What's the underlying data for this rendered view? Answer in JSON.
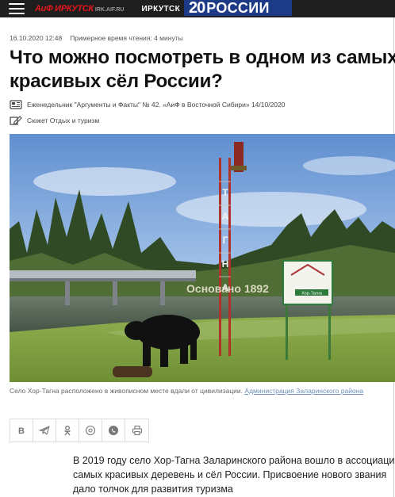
{
  "header": {
    "logo_main": "АиФ ИРКУТСК",
    "logo_sub": "IRK.AIF.RU",
    "city": "ИРКУТСК",
    "promo_number": "20",
    "promo_word": "РОССИИ"
  },
  "article": {
    "date": "16.10.2020 12:48",
    "read_time": "Примерное время чтения: 4 минуты",
    "title": "Что можно посмотреть в одном из самых красивых сёл России?",
    "source": "Еженедельник \"Аргументы и Факты\" № 42. «АиФ в Восточной Сибири» 14/10/2020",
    "topic": "Сюжет Отдых и туризм",
    "photo_sign_text": "Основано 1892",
    "photo_tower_letters": [
      "Т",
      "А",
      "Г",
      "Н",
      "А"
    ],
    "photo_board_text": "Хор-Тагна",
    "caption_text": "Село Хор-Тагна расположено в живописном месте вдали от цивилизации. ",
    "caption_link": "Администрация Заларинского района",
    "paragraph": "В 2019 году село Хор-Тагна Заларинского района вошло в ассоциацию самых красивых деревень и сёл России. Присвоение нового звания дало толчок для развития туризма"
  },
  "share": {
    "buttons": [
      "vk-icon",
      "telegram-icon",
      "odnoklassniki-icon",
      "email-icon",
      "viber-icon",
      "print-icon"
    ]
  },
  "colors": {
    "topbar": "#1e1e1e",
    "brand_red": "#e3161b",
    "promo_blue": "#1d3a86",
    "link": "#6b8fb8"
  }
}
